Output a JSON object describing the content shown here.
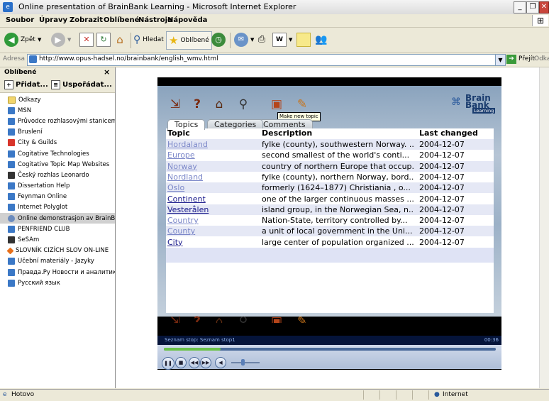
{
  "window": {
    "title": "Online presentation of BrainBank Learning - Microsoft Internet Explorer",
    "controls": [
      "_",
      "❐",
      "✕"
    ]
  },
  "menu": [
    "Soubor",
    "Úpravy",
    "Zobrazit",
    "Oblíbené",
    "Nástroje",
    "Nápověda"
  ],
  "toolbar": {
    "back_label": "Zpět",
    "search_label": "Hledat",
    "favorites_label": "Oblíbené"
  },
  "address": {
    "label": "Adresa",
    "url": "http://www.opus-hadsel.no/brainbank/english_wmv.html",
    "go_label": "Přejít",
    "links_label": "Odkazy"
  },
  "sidebar": {
    "title": "Oblíbené",
    "close": "×",
    "add_label": "Přidat...",
    "organize_label": "Uspořádat...",
    "items": [
      {
        "label": "Odkazy",
        "icon": "folder"
      },
      {
        "label": "MSN",
        "icon": "ie"
      },
      {
        "label": "Průvodce rozhlasovými stanicemi",
        "icon": "ie"
      },
      {
        "label": "Bruslení",
        "icon": "ie"
      },
      {
        "label": "City & Guilds",
        "icon": "red"
      },
      {
        "label": "Cogitative Technologies",
        "icon": "ie"
      },
      {
        "label": "Cogitative Topic Map Websites",
        "icon": "ie"
      },
      {
        "label": "Český rozhlas Leonardo",
        "icon": "dark"
      },
      {
        "label": "Dissertation Help",
        "icon": "ie"
      },
      {
        "label": "Feynman Online",
        "icon": "ie"
      },
      {
        "label": "Internet Polyglot",
        "icon": "ie"
      },
      {
        "label": "Online demonstrasjon av BrainBa...",
        "icon": "globe",
        "selected": true
      },
      {
        "label": "PENFRIEND CLUB",
        "icon": "ie"
      },
      {
        "label": "SeSAm",
        "icon": "dark"
      },
      {
        "label": "SLOVNÍK CIZÍCH SLOV ON-LINE",
        "icon": "orange"
      },
      {
        "label": "Učební materiály - Jazyky",
        "icon": "ie"
      },
      {
        "label": "Правда.Ру Новости и аналитика",
        "icon": "ie"
      },
      {
        "label": "Русский язык",
        "icon": "ie"
      }
    ]
  },
  "app": {
    "tooltip": "Make new topic",
    "logo": {
      "line1": "Brain",
      "line2": "Bank",
      "line3": "Learning"
    },
    "tabs": [
      "Topics",
      "Categories",
      "Comments"
    ],
    "columns": [
      "Topic",
      "Description",
      "Last changed"
    ],
    "rows": [
      {
        "topic": "Hordaland",
        "description": "fylke (county), southwestern Norway. ...",
        "date": "2004-12-07",
        "visited": true
      },
      {
        "topic": "Europe",
        "description": "second smallest of the world's conti...",
        "date": "2004-12-07",
        "visited": true
      },
      {
        "topic": "Norway",
        "description": "country of northern Europe that occup...",
        "date": "2004-12-07",
        "visited": true
      },
      {
        "topic": "Nordland",
        "description": "fylke (county), northern Norway, bord...",
        "date": "2004-12-07",
        "visited": true
      },
      {
        "topic": "Oslo",
        "description": "formerly (1624–1877) Christiania , o...",
        "date": "2004-12-07",
        "visited": true
      },
      {
        "topic": "Continent",
        "description": "one of the larger continuous masses ...",
        "date": "2004-12-07",
        "visited": false
      },
      {
        "topic": "Vesterålen",
        "description": "island group, in the Norwegian Sea, n...",
        "date": "2004-12-07",
        "visited": false
      },
      {
        "topic": "Country",
        "description": "Nation-State, territory controlled by...",
        "date": "2004-12-07",
        "visited": true
      },
      {
        "topic": "County",
        "description": "a unit of local government in the Uni...",
        "date": "2004-12-07",
        "visited": true
      },
      {
        "topic": "City",
        "description": "large center of population organized ...",
        "date": "2004-12-07",
        "visited": false
      }
    ]
  },
  "media": {
    "status": "Seznam stop: Seznam stop1",
    "time": "00:36",
    "progress": 0.17
  },
  "statusbar": {
    "left": "Hotovo",
    "zone": "Internet"
  },
  "colors": {
    "link": "#1a1a8c",
    "visited_link": "#7a86c8",
    "alt_row": "#e5e8f5"
  }
}
